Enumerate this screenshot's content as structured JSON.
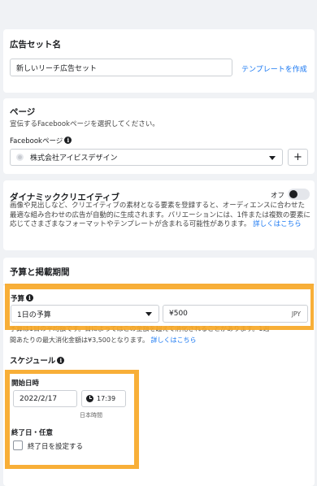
{
  "adset_name": {
    "heading": "広告セット名",
    "value": "新しいリーチ広告セット",
    "template_link": "テンプレートを作成"
  },
  "page": {
    "heading": "ページ",
    "description": "宣伝するFacebookページを選択してください。",
    "field_label": "Facebookページ",
    "selected_page": "株式会社アイビスデザイン",
    "add_label": "+"
  },
  "dynamic_creative": {
    "heading": "ダイナミッククリエイティブ",
    "toggle_label": "オフ",
    "description": "画像や見出しなど、クリエイティブの素材となる要素を登録すると、オーディエンスに合わせた最適な組み合わせの広告が自動的に生成されます。バリエーションには、1件または複数の要素に応じてさまざまなフォーマットやテンプレートが含まれる可能性があります。",
    "learn_more": "詳しくはこちら"
  },
  "budget": {
    "heading": "予算と掲載期間",
    "field_label": "予算",
    "type_value": "1日の予算",
    "amount_value": "¥500",
    "currency": "JPY",
    "note_hidden_line": "予算は1日の平均額です。日によってはこの金額を超えて消化されることがあります。1週",
    "note_line": "間あたりの最大消化金額は¥3,500となります。",
    "learn_more": "詳しくはこちら"
  },
  "schedule": {
    "heading": "スケジュール",
    "start_label": "開始日時",
    "start_date": "2022/2/17",
    "start_time": "17:39",
    "timezone": "日本時間",
    "end_label": "終了日・任意",
    "end_checkbox_label": "終了日を設定する"
  },
  "colors": {
    "highlight": "#f7a827",
    "link": "#1877f2",
    "background": "#f0f2f5"
  }
}
